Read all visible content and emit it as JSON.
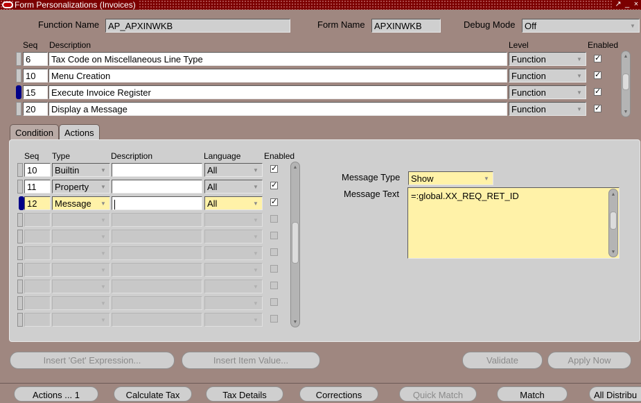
{
  "window": {
    "title": "Form Personalizations (Invoices)",
    "controls": [
      "↗",
      "_",
      "×"
    ]
  },
  "header": {
    "function_name_label": "Function Name",
    "function_name_value": "AP_APXINWKB",
    "form_name_label": "Form Name",
    "form_name_value": "APXINWKB",
    "debug_mode_label": "Debug Mode",
    "debug_mode_value": "Off"
  },
  "rules": {
    "col_seq": "Seq",
    "col_description": "Description",
    "col_level": "Level",
    "col_enabled": "Enabled",
    "rows": [
      {
        "seq": "6",
        "description": "Tax Code on Miscellaneous Line Type",
        "level": "Function",
        "enabled": "✓"
      },
      {
        "seq": "10",
        "description": "Menu Creation",
        "level": "Function",
        "enabled": "✓"
      },
      {
        "seq": "15",
        "description": "Execute Invoice Register",
        "level": "Function",
        "enabled": "✓"
      },
      {
        "seq": "20",
        "description": "Display a Message",
        "level": "Function",
        "enabled": "✓"
      }
    ]
  },
  "tabs": [
    {
      "label": "Condition"
    },
    {
      "label": "Actions"
    }
  ],
  "actions": {
    "col_seq": "Seq",
    "col_type": "Type",
    "col_description": "Description",
    "col_language": "Language",
    "col_enabled": "Enabled",
    "rows": [
      {
        "seq": "10",
        "type": "Builtin",
        "description": "",
        "language": "All",
        "enabled": "✓"
      },
      {
        "seq": "11",
        "type": "Property",
        "description": "",
        "language": "All",
        "enabled": "✓"
      },
      {
        "seq": "12",
        "type": "Message",
        "description": "",
        "language": "All",
        "enabled": "✓"
      }
    ]
  },
  "detail": {
    "message_type_label": "Message Type",
    "message_type_value": "Show",
    "message_text_label": "Message Text",
    "message_text_value": "=:global.XX_REQ_RET_ID"
  },
  "buttons": {
    "insert_get": "Insert 'Get' Expression...",
    "insert_item": "Insert Item Value...",
    "validate": "Validate",
    "apply_now": "Apply Now"
  },
  "bottom_buttons": [
    "Actions ... 1",
    "Calculate Tax",
    "Tax Details",
    "Corrections",
    "Quick Match",
    "Match",
    "All Distribu"
  ],
  "colors": {
    "titlebar": "#7b0000",
    "background": "#9f8780",
    "panel": "#cfcfcf",
    "highlight": "#fff2a8",
    "current_row": "#000088"
  }
}
